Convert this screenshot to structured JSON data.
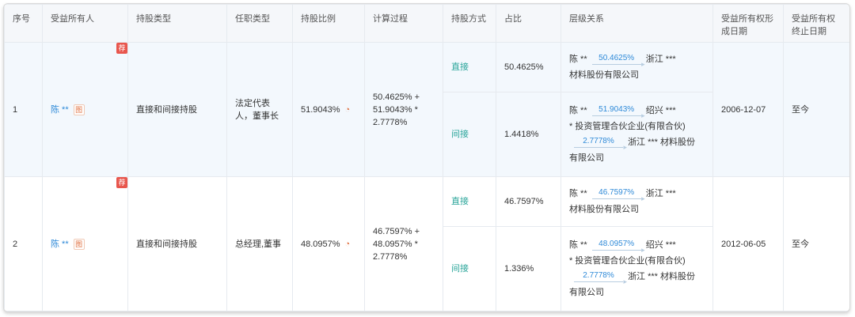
{
  "headers": [
    "序号",
    "受益所有人",
    "持股类型",
    "任职类型",
    "持股比例",
    "计算过程",
    "持股方式",
    "占比",
    "层级关系",
    "受益所有权形成日期",
    "受益所有权终止日期"
  ],
  "rows": [
    {
      "index": "1",
      "tag": "荐",
      "owner": "陈 **",
      "owner_icon": "图",
      "holding_type": "直接和间接持股",
      "role": "法定代表人，董事长",
      "ratio": "51.9043%",
      "calc": "50.4625% + 51.9043% * 2.7778%",
      "start_date": "2006-12-07",
      "end_date": "至今",
      "subs": [
        {
          "mode": "直接",
          "share": "50.4625%",
          "chain": {
            "a": "陈 **",
            "p1": "50.4625%",
            "b": "浙江 ***",
            "b2": "材料股份有限公司"
          }
        },
        {
          "mode": "间接",
          "share": "1.4418%",
          "chain": {
            "a": "陈 **",
            "p1": "51.9043%",
            "b": "绍兴 ***",
            "b2": "* 投资管理合伙企业(有限合伙)",
            "p2": "2.7778%",
            "c": "浙江 *** 材料股份",
            "c2": "有限公司"
          }
        }
      ]
    },
    {
      "index": "2",
      "tag": "荐",
      "owner": "陈 **",
      "owner_icon": "图",
      "holding_type": "直接和间接持股",
      "role": "总经理,董事",
      "ratio": "48.0957%",
      "calc": "46.7597% + 48.0957% * 2.7778%",
      "start_date": "2012-06-05",
      "end_date": "至今",
      "subs": [
        {
          "mode": "直接",
          "share": "46.7597%",
          "chain": {
            "a": "陈 **",
            "p1": "46.7597%",
            "b": "浙江 ***",
            "b2": "材料股份有限公司"
          }
        },
        {
          "mode": "间接",
          "share": "1.336%",
          "chain": {
            "a": "陈 **",
            "p1": "48.0957%",
            "b": "绍兴 ***",
            "b2": "* 投资管理合伙企业(有限合伙)",
            "p2": "2.7778%",
            "c": "浙江 *** 材料股份",
            "c2": "有限公司"
          }
        }
      ]
    }
  ],
  "colors": {
    "link": "#2f8ad8",
    "mode": "#2aa59a",
    "tag": "#e8564d",
    "header_bg": "#f5f7fa",
    "row_highlight": "#f3f8fd"
  },
  "icons": {
    "owner_icon": "graph-icon",
    "ratio_icon": "pie-chart-icon",
    "arrow": "arrow-right-icon"
  }
}
